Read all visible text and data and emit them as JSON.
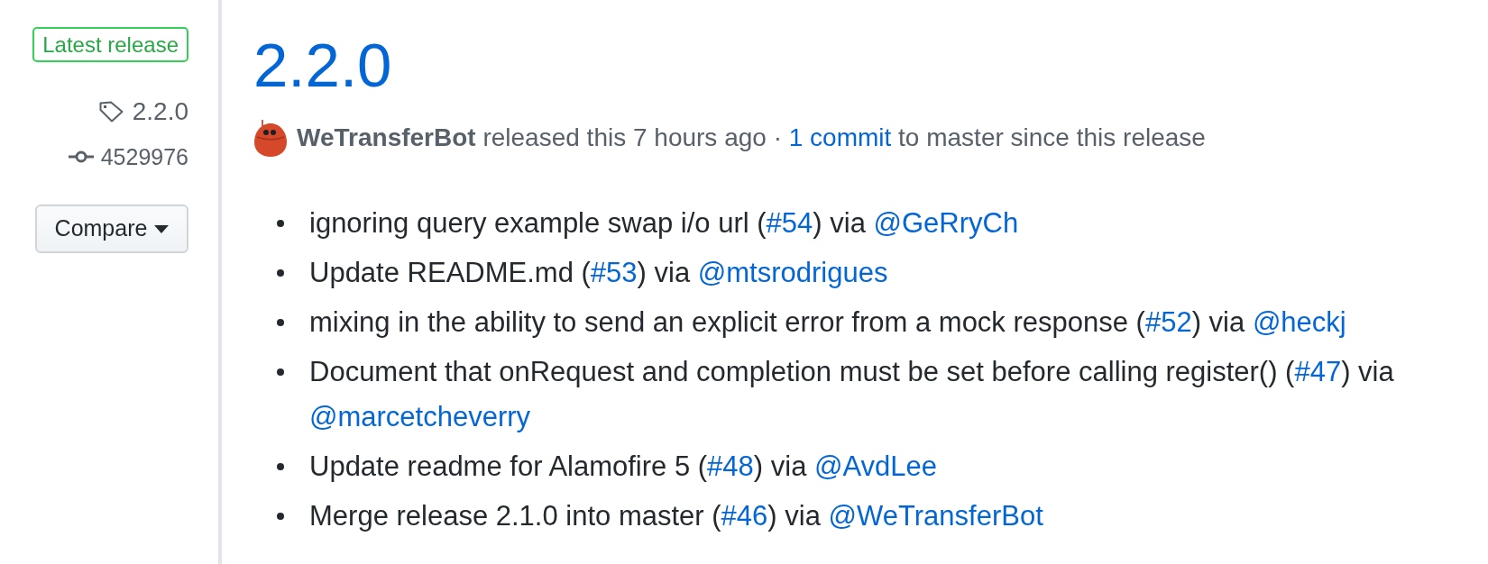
{
  "sidebar": {
    "badge": "Latest release",
    "tag": "2.2.0",
    "commit": "4529976",
    "compare_button": "Compare"
  },
  "release": {
    "title": "2.2.0",
    "author": "WeTransferBot",
    "byline": [
      {
        "kind": "text",
        "text": " released this 7 hours ago · "
      },
      {
        "kind": "link",
        "text": "1 commit"
      },
      {
        "kind": "text",
        "text": " to master since this release"
      }
    ]
  },
  "notes": [
    {
      "parts": [
        {
          "kind": "text",
          "text": "ignoring query example swap i/o url ("
        },
        {
          "kind": "pr",
          "text": "#54"
        },
        {
          "kind": "text",
          "text": ") via "
        },
        {
          "kind": "user",
          "text": "@GeRryCh"
        }
      ]
    },
    {
      "parts": [
        {
          "kind": "text",
          "text": "Update README.md ("
        },
        {
          "kind": "pr",
          "text": "#53"
        },
        {
          "kind": "text",
          "text": ") via "
        },
        {
          "kind": "user",
          "text": "@mtsrodrigues"
        }
      ]
    },
    {
      "parts": [
        {
          "kind": "text",
          "text": "mixing in the ability to send an explicit error from a mock response ("
        },
        {
          "kind": "pr",
          "text": "#52"
        },
        {
          "kind": "text",
          "text": ") via "
        },
        {
          "kind": "user",
          "text": "@heckj"
        }
      ]
    },
    {
      "parts": [
        {
          "kind": "text",
          "text": "Document that onRequest and completion must be set before calling register() ("
        },
        {
          "kind": "pr",
          "text": "#47"
        },
        {
          "kind": "text",
          "text": ") via "
        },
        {
          "kind": "user",
          "text": "@marcetcheverry"
        }
      ]
    },
    {
      "parts": [
        {
          "kind": "text",
          "text": "Update readme for Alamofire 5 ("
        },
        {
          "kind": "pr",
          "text": "#48"
        },
        {
          "kind": "text",
          "text": ") via "
        },
        {
          "kind": "user",
          "text": "@AvdLee"
        }
      ]
    },
    {
      "parts": [
        {
          "kind": "text",
          "text": "Merge release 2.1.0 into master ("
        },
        {
          "kind": "pr",
          "text": "#46"
        },
        {
          "kind": "text",
          "text": ") via "
        },
        {
          "kind": "user",
          "text": "@WeTransferBot"
        }
      ]
    }
  ]
}
